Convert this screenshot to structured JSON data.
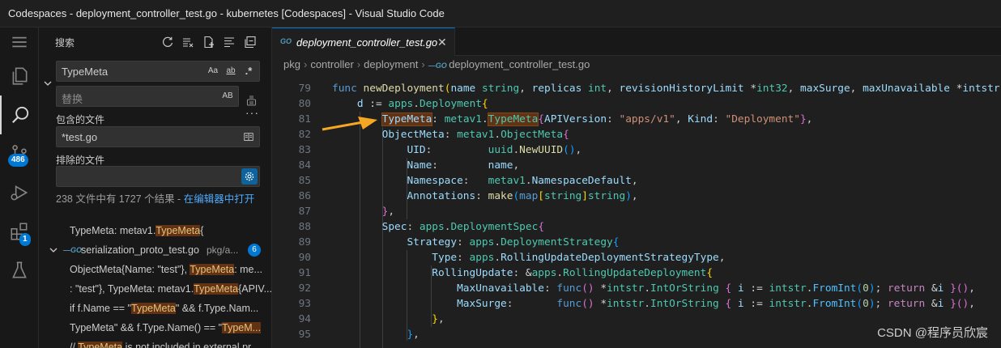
{
  "window": {
    "title": "Codespaces - deployment_controller_test.go - kubernetes [Codespaces] - Visual Studio Code"
  },
  "activity": {
    "items": [
      {
        "name": "explorer-icon"
      },
      {
        "name": "search-icon"
      },
      {
        "name": "source-control-icon",
        "badge": "486"
      },
      {
        "name": "run-debug-icon"
      },
      {
        "name": "extensions-icon",
        "badge": "1"
      },
      {
        "name": "testing-icon"
      }
    ]
  },
  "search": {
    "title": "搜索",
    "query": "TypeMeta",
    "replace_placeholder": "替换",
    "include_label": "包含的文件",
    "include_value": "*test.go",
    "exclude_label": "排除的文件",
    "exclude_value": "",
    "opt_case": "Aa",
    "opt_word": "ab",
    "opt_regex": ".*",
    "opt_preserve_case": "AB",
    "summary_prefix": "238 文件中有 1727 个结果 - ",
    "summary_link": "在编辑器中打开"
  },
  "results": {
    "row1": {
      "pre": "TypeMeta: metav1.",
      "hit": "TypeMeta",
      "post": "{"
    },
    "file": {
      "name": "serialization_proto_test.go",
      "path": "pkg/a...",
      "count": "6"
    },
    "rows": [
      {
        "pre": "ObjectMeta{Name: \"test\"}, ",
        "hit": "TypeMeta",
        "post": ": me..."
      },
      {
        "pre": ": \"test\"}, TypeMeta: metav1.",
        "hit": "TypeMeta",
        "post": "{APIV..."
      },
      {
        "pre": "if f.Name == \"",
        "hit": "TypeMeta",
        "post": "\" && f.Type.Nam..."
      },
      {
        "pre": "TypeMeta\" && f.Type.Name() == \"",
        "hit": "TypeM...",
        "post": ""
      },
      {
        "pre": "// ",
        "hit": "TypeMeta",
        "post": " is not included in external pr..."
      }
    ]
  },
  "editor": {
    "tab_label": "deployment_controller_test.go",
    "tab_lang": "GO",
    "breadcrumb": [
      "pkg",
      "controller",
      "deployment",
      "deployment_controller_test.go"
    ],
    "line_numbers": [
      "79",
      "80",
      "81",
      "82",
      "83",
      "84",
      "85",
      "86",
      "87",
      "88",
      "89",
      "90",
      "91",
      "92",
      "93",
      "94",
      "95"
    ]
  },
  "watermark": "CSDN @程序员欣宸",
  "colors": {
    "accent": "#0078d4",
    "match_highlight": "#613214",
    "arrow": "#f5a623"
  }
}
